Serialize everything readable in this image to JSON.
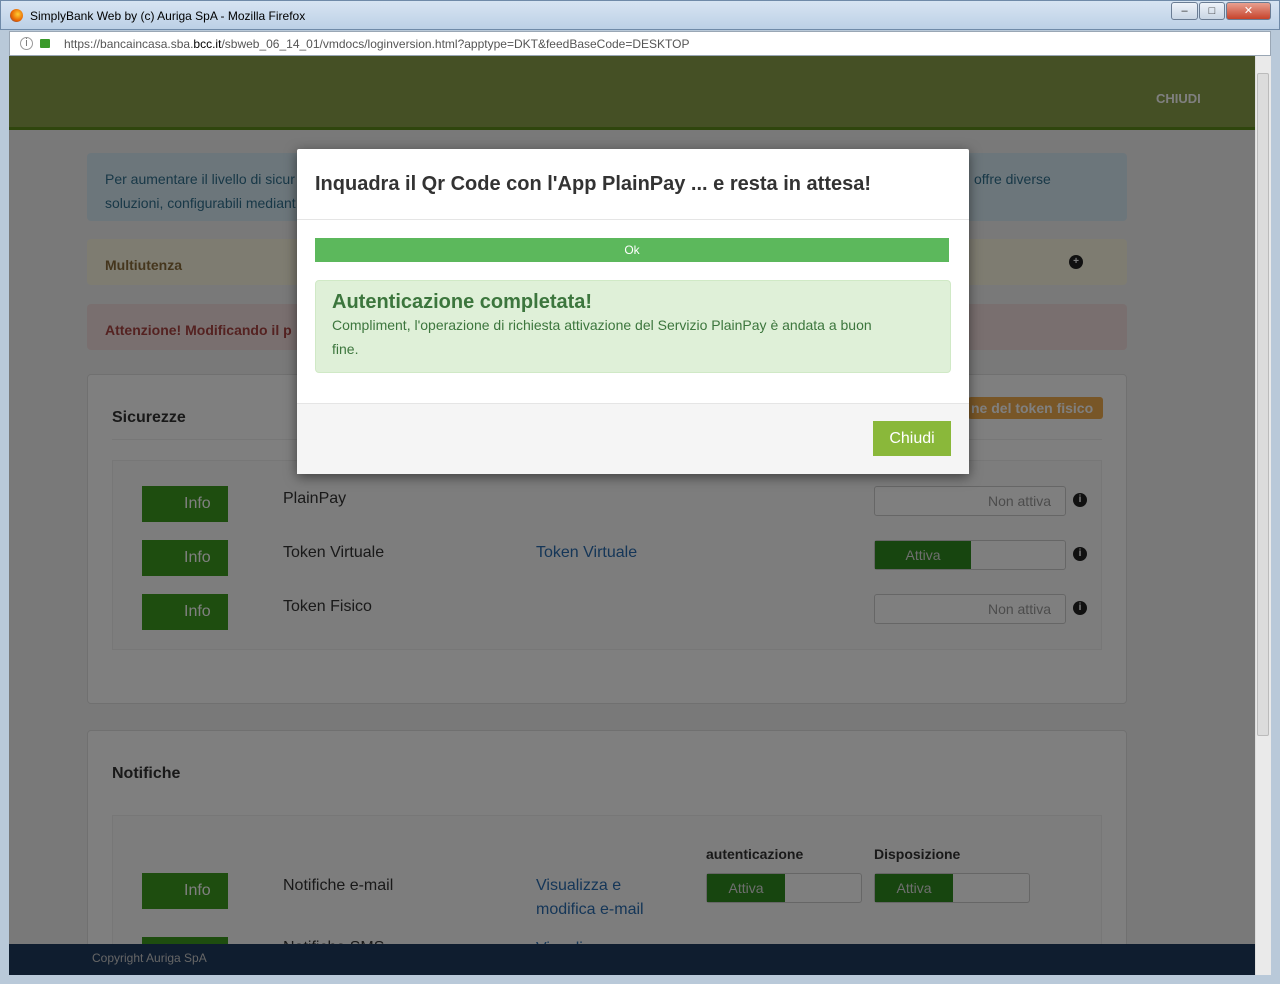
{
  "window": {
    "title": "SimplyBank Web by (c) Auriga SpA - Mozilla Firefox",
    "url_prefix": "https://bancaincasa.sba.",
    "url_domain": "bcc.it",
    "url_suffix": "/sbweb_06_14_01/vmdocs/loginversion.html?apptype=DKT&feedBaseCode=DESKTOP"
  },
  "header": {
    "close_label": "CHIUDI"
  },
  "info_box": {
    "text_left": "Per aumentare il livello di sicur",
    "text_right": "offre diverse",
    "text_line2": "soluzioni, configurabili mediant"
  },
  "multiutenza": {
    "label": "Multiutenza"
  },
  "warning": {
    "text": "Attenzione! Modificando il p"
  },
  "sicurezze": {
    "title": "Sicurezze",
    "token_button": "ne del token fisico",
    "info_label": "Info",
    "rows": [
      {
        "name": "PlainPay",
        "link": "",
        "state": "Non attiva",
        "active": false
      },
      {
        "name": "Token Virtuale",
        "link": "Token Virtuale",
        "state": "Attiva",
        "active": true
      },
      {
        "name": "Token Fisico",
        "link": "",
        "state": "Non attiva",
        "active": false
      }
    ]
  },
  "notifiche": {
    "title": "Notifiche",
    "col1": "autenticazione",
    "col2": "Disposizione",
    "rows": [
      {
        "name": "Notifiche e-mail",
        "link": "Visualizza e modifica e-mail",
        "state1": "Attiva",
        "state2": "Attiva"
      },
      {
        "name": "Notifiche SMS",
        "link": "Visualizza"
      }
    ]
  },
  "footer": {
    "copyright": "Copyright Auriga SpA"
  },
  "modal": {
    "title": "Inquadra il Qr Code con l'App PlainPay ... e resta in attesa!",
    "progress_label": "Ok",
    "progress": 100,
    "alert_title": "Autenticazione completata!",
    "alert_text": "Compliment, l'operazione di richiesta attivazione del Servizio PlainPay è andata a buon",
    "alert_text2": "fine.",
    "close_button": "Chiudi"
  }
}
